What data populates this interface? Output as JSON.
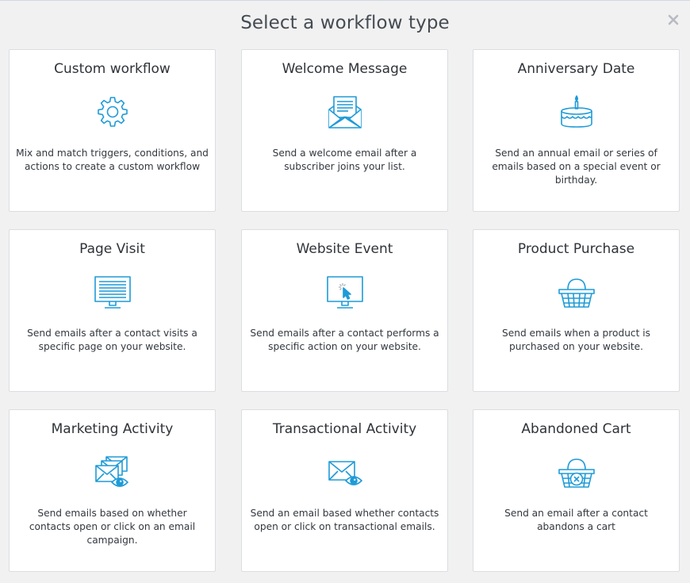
{
  "modal": {
    "title": "Select a workflow type",
    "close_icon": "close-icon"
  },
  "colors": {
    "icon_blue": "#1e9bd7",
    "card_background": "#ffffff",
    "page_background": "#f1f1f2"
  },
  "cards": [
    {
      "title": "Custom workflow",
      "description": "Mix and match triggers, conditions, and actions to create a custom workflow",
      "icon": "gear-icon"
    },
    {
      "title": "Welcome Message",
      "description": "Send a welcome email after a subscriber joins your list.",
      "icon": "envelope-letter-icon"
    },
    {
      "title": "Anniversary Date",
      "description": "Send an annual email or series of emails based on a special event or birthday.",
      "icon": "birthday-cake-icon"
    },
    {
      "title": "Page Visit",
      "description": "Send emails after a contact visits a specific page on your website.",
      "icon": "monitor-page-icon"
    },
    {
      "title": "Website Event",
      "description": "Send emails after a contact performs a specific action on your website.",
      "icon": "monitor-cursor-icon"
    },
    {
      "title": "Product Purchase",
      "description": "Send emails when a product is purchased on your website.",
      "icon": "shopping-basket-icon"
    },
    {
      "title": "Marketing Activity",
      "description": "Send emails based on whether contacts open or click on an email campaign.",
      "icon": "envelopes-eye-icon"
    },
    {
      "title": "Transactional Activity",
      "description": "Send an email based whether contacts open or click on transactional emails.",
      "icon": "envelope-eye-icon"
    },
    {
      "title": "Abandoned Cart",
      "description": "Send an email after a contact abandons a cart",
      "icon": "basket-cancel-icon"
    }
  ]
}
